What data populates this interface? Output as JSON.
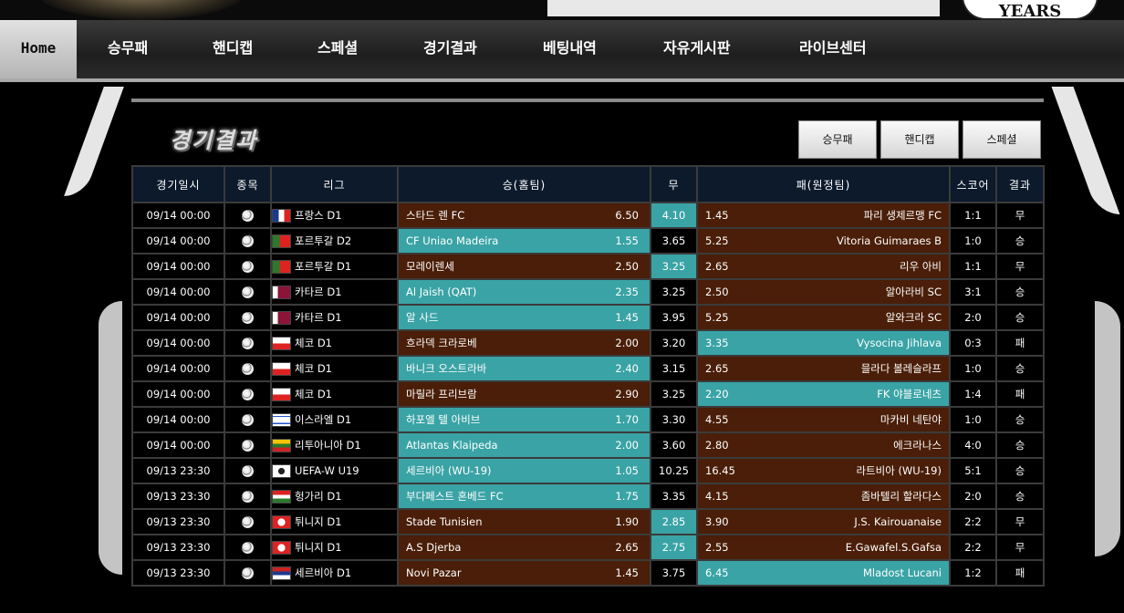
{
  "banner": {
    "logo_text": "",
    "badge": "YEARS"
  },
  "nav": [
    {
      "label": "Home"
    },
    {
      "label": "승무패"
    },
    {
      "label": "핸디캡"
    },
    {
      "label": "스페셜"
    },
    {
      "label": "경기결과"
    },
    {
      "label": "베팅내역"
    },
    {
      "label": "자유게시판"
    },
    {
      "label": "라이브센터"
    }
  ],
  "page": {
    "title": "경기결과"
  },
  "filters": [
    {
      "label": "승무패"
    },
    {
      "label": "핸디캡"
    },
    {
      "label": "스페셜"
    }
  ],
  "table": {
    "headers": [
      "경기일시",
      "종목",
      "리그",
      "승(홈팀)",
      "무",
      "패(원정팀)",
      "스코어",
      "결과"
    ],
    "rows": [
      {
        "date": "09/14 00:00",
        "league": "프랑스 D1",
        "flag": "fr",
        "home": "스타드 렌 FC",
        "home_odd": "6.50",
        "draw": "4.10",
        "away_odd": "1.45",
        "away": "파리 생제르맹 FC",
        "score": "1:1",
        "result": "무",
        "pick": "draw"
      },
      {
        "date": "09/14 00:00",
        "league": "포르투갈 D2",
        "flag": "pt",
        "home": "CF Uniao Madeira",
        "home_odd": "1.55",
        "draw": "3.65",
        "away_odd": "5.25",
        "away": "Vitoria Guimaraes B",
        "score": "1:0",
        "result": "승",
        "pick": "home"
      },
      {
        "date": "09/14 00:00",
        "league": "포르투갈 D1",
        "flag": "pt",
        "home": "모레이렌세",
        "home_odd": "2.50",
        "draw": "3.25",
        "away_odd": "2.65",
        "away": "리우 아비",
        "score": "1:1",
        "result": "무",
        "pick": "draw"
      },
      {
        "date": "09/14 00:00",
        "league": "카타르 D1",
        "flag": "qa",
        "home": "Al Jaish (QAT)",
        "home_odd": "2.35",
        "draw": "3.25",
        "away_odd": "2.50",
        "away": "알아라비 SC",
        "score": "3:1",
        "result": "승",
        "pick": "home"
      },
      {
        "date": "09/14 00:00",
        "league": "카타르 D1",
        "flag": "qa",
        "home": "알 사드",
        "home_odd": "1.45",
        "draw": "3.95",
        "away_odd": "5.25",
        "away": "알와크라 SC",
        "score": "2:0",
        "result": "승",
        "pick": "home"
      },
      {
        "date": "09/14 00:00",
        "league": "체코 D1",
        "flag": "cz",
        "home": "흐라덱 크라로베",
        "home_odd": "2.00",
        "draw": "3.20",
        "away_odd": "3.35",
        "away": "Vysocina Jihlava",
        "score": "0:3",
        "result": "패",
        "pick": "away"
      },
      {
        "date": "09/14 00:00",
        "league": "체코 D1",
        "flag": "cz",
        "home": "바니크 오스트라바",
        "home_odd": "2.40",
        "draw": "3.15",
        "away_odd": "2.65",
        "away": "믈라다 볼레슬라프",
        "score": "1:0",
        "result": "승",
        "pick": "home"
      },
      {
        "date": "09/14 00:00",
        "league": "체코 D1",
        "flag": "cz",
        "home": "마릴라 프리브람",
        "home_odd": "2.90",
        "draw": "3.25",
        "away_odd": "2.20",
        "away": "FK 야블로네츠",
        "score": "1:4",
        "result": "패",
        "pick": "away"
      },
      {
        "date": "09/14 00:00",
        "league": "이스라엘 D1",
        "flag": "il",
        "home": "하포엘 텔 아비브",
        "home_odd": "1.70",
        "draw": "3.30",
        "away_odd": "4.55",
        "away": "마카비 네탄야",
        "score": "1:0",
        "result": "승",
        "pick": "home"
      },
      {
        "date": "09/14 00:00",
        "league": "리투아니아 D1",
        "flag": "lt",
        "home": "Atlantas Klaipeda",
        "home_odd": "2.00",
        "draw": "3.60",
        "away_odd": "2.80",
        "away": "에크라나스",
        "score": "4:0",
        "result": "승",
        "pick": "home"
      },
      {
        "date": "09/13 23:30",
        "league": "UEFA-W U19",
        "flag": "uefa",
        "home": "세르비아 (WU-19)",
        "home_odd": "1.05",
        "draw": "10.25",
        "away_odd": "16.45",
        "away": "라트비아 (WU-19)",
        "score": "5:1",
        "result": "승",
        "pick": "home"
      },
      {
        "date": "09/13 23:30",
        "league": "헝가리 D1",
        "flag": "hu",
        "home": "부다페스트 혼베드 FC",
        "home_odd": "1.75",
        "draw": "3.35",
        "away_odd": "4.15",
        "away": "좀바텔리 할라다스",
        "score": "2:0",
        "result": "승",
        "pick": "home"
      },
      {
        "date": "09/13 23:30",
        "league": "튀니지 D1",
        "flag": "tn",
        "home": "Stade Tunisien",
        "home_odd": "1.90",
        "draw": "2.85",
        "away_odd": "3.90",
        "away": "J.S. Kairouanaise",
        "score": "2:2",
        "result": "무",
        "pick": "draw"
      },
      {
        "date": "09/13 23:30",
        "league": "튀니지 D1",
        "flag": "tn",
        "home": "A.S Djerba",
        "home_odd": "2.65",
        "draw": "2.75",
        "away_odd": "2.55",
        "away": "E.Gawafel.S.Gafsa",
        "score": "2:2",
        "result": "무",
        "pick": "draw"
      },
      {
        "date": "09/13 23:30",
        "league": "세르비아 D1",
        "flag": "rs",
        "home": "Novi Pazar",
        "home_odd": "1.45",
        "draw": "3.75",
        "away_odd": "6.45",
        "away": "Mladost Lucani",
        "score": "1:2",
        "result": "패",
        "pick": "away"
      }
    ]
  },
  "colors": {
    "win_cell": "#3aa3a5",
    "lose_cell": "#4a1e08",
    "header_bg": "#0c1a2c"
  },
  "icons": {
    "sport": "soccer-ball-icon"
  }
}
